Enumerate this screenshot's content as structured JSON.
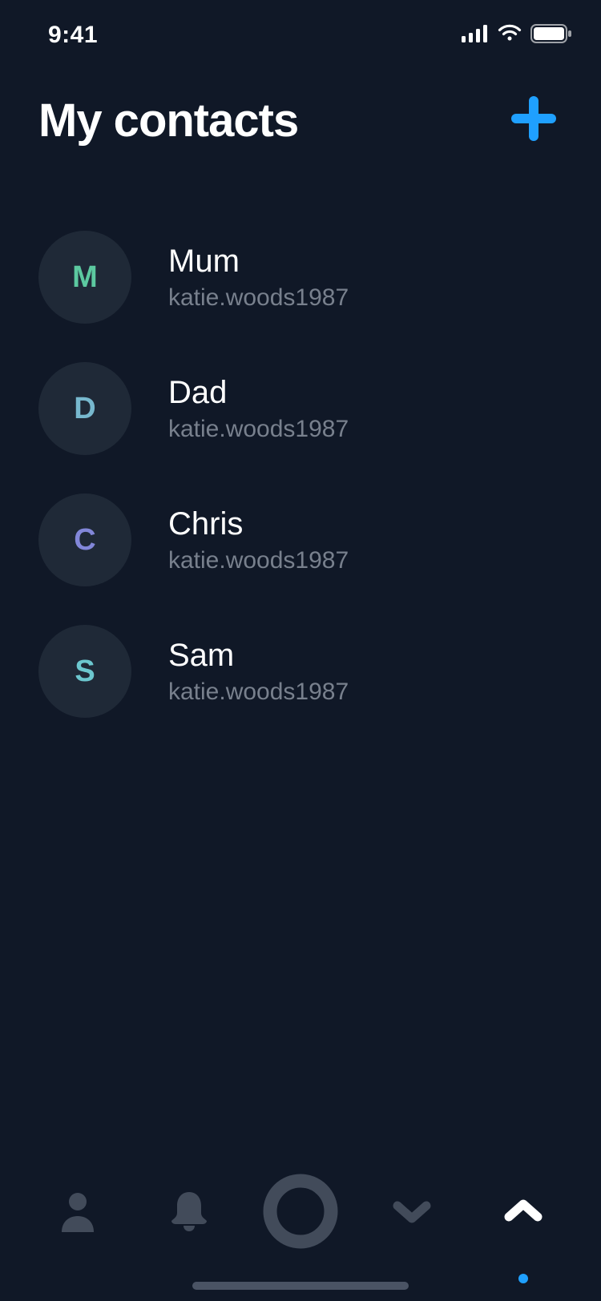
{
  "status": {
    "time": "9:41"
  },
  "header": {
    "title": "My contacts"
  },
  "colors": {
    "accent": "#1FA0FF",
    "avatar_bg": "#1F2937",
    "muted_icon": "#424B5A",
    "active_icon": "#FFFFFF"
  },
  "contacts": [
    {
      "initial": "M",
      "initial_color": "#5CC9A0",
      "name": "Mum",
      "handle": "katie.woods1987"
    },
    {
      "initial": "D",
      "initial_color": "#77B8CE",
      "name": "Dad",
      "handle": "katie.woods1987"
    },
    {
      "initial": "C",
      "initial_color": "#8287D9",
      "name": "Chris",
      "handle": "katie.woods1987"
    },
    {
      "initial": "S",
      "initial_color": "#6CC7CF",
      "name": "Sam",
      "handle": "katie.woods1987"
    }
  ],
  "nav": {
    "items": [
      {
        "name": "contacts",
        "icon": "person-icon",
        "active": false
      },
      {
        "name": "alerts",
        "icon": "bell-icon",
        "active": false
      },
      {
        "name": "home",
        "icon": "ring-icon",
        "active": false
      },
      {
        "name": "collapse",
        "icon": "chevron-down-icon",
        "active": false
      },
      {
        "name": "expand",
        "icon": "chevron-up-icon",
        "active": true
      }
    ]
  }
}
